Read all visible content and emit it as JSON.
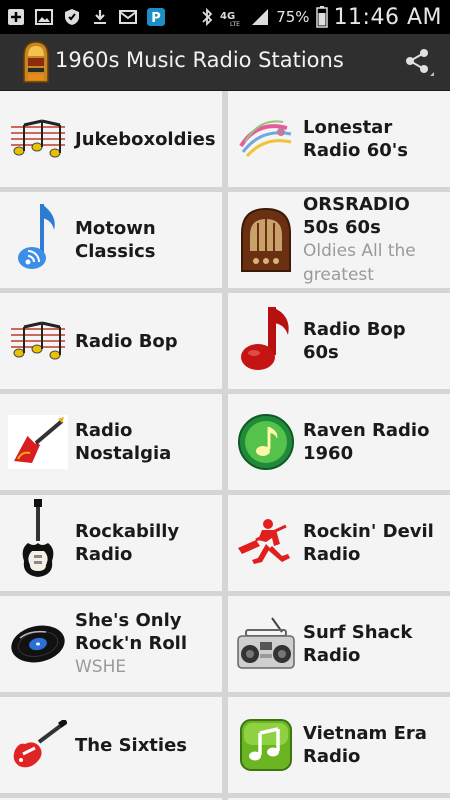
{
  "status_bar": {
    "battery": "75%",
    "time": "11:46 AM",
    "network": "4G"
  },
  "app": {
    "title": "1960s Music Radio Stations"
  },
  "stations": [
    {
      "name": "Jukeboxoldies",
      "subtitle": "",
      "icon": "music-notes-icon"
    },
    {
      "name": "Lonestar Radio 60's",
      "subtitle": "",
      "icon": "swirl-art-icon"
    },
    {
      "name": "Motown Classics",
      "subtitle": "",
      "icon": "blue-note-icon"
    },
    {
      "name": "ORSRADIO 50s 60s",
      "subtitle": "Oldies All the greatest",
      "icon": "vintage-radio-icon"
    },
    {
      "name": "Radio Bop",
      "subtitle": "",
      "icon": "music-notes-icon"
    },
    {
      "name": "Radio Bop 60s",
      "subtitle": "",
      "icon": "red-note-icon"
    },
    {
      "name": "Radio Nostalgia",
      "subtitle": "",
      "icon": "guitar-flame-icon"
    },
    {
      "name": "Raven Radio 1960",
      "subtitle": "",
      "icon": "green-note-badge-icon"
    },
    {
      "name": "Rockabilly Radio",
      "subtitle": "",
      "icon": "electric-guitar-icon"
    },
    {
      "name": "Rockin' Devil Radio",
      "subtitle": "",
      "icon": "guitarist-silhouette-icon"
    },
    {
      "name": "She's Only Rock'n Roll",
      "subtitle": "WSHE",
      "icon": "vinyl-record-icon"
    },
    {
      "name": "Surf Shack Radio",
      "subtitle": "",
      "icon": "boombox-icon"
    },
    {
      "name": "The Sixties",
      "subtitle": "",
      "icon": "red-guitar-icon"
    },
    {
      "name": "Vietnam Era Radio",
      "subtitle": "",
      "icon": "music-app-icon"
    }
  ]
}
